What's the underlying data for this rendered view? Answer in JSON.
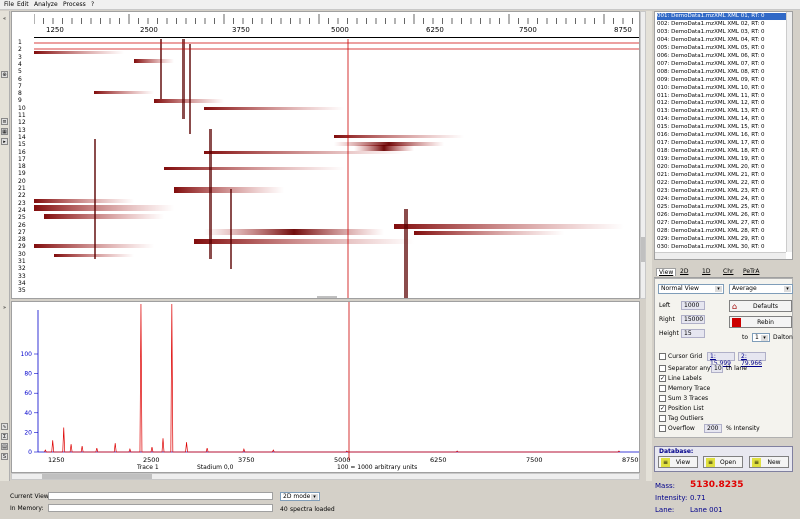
{
  "menu": [
    "File",
    "Edit",
    "Analyze",
    "Process",
    "?"
  ],
  "x_ticks": [
    "1250",
    "2500",
    "3750",
    "5000",
    "6250",
    "7500",
    "8750"
  ],
  "lanes": [
    "1",
    "2",
    "3",
    "4",
    "5",
    "6",
    "7",
    "8",
    "9",
    "10",
    "11",
    "12",
    "13",
    "14",
    "15",
    "16",
    "17",
    "18",
    "19",
    "20",
    "21",
    "22",
    "23",
    "24",
    "25",
    "26",
    "27",
    "28",
    "29",
    "30",
    "31",
    "32",
    "33",
    "34",
    "35"
  ],
  "spectrum": {
    "y_ticks": [
      "100",
      "80",
      "60",
      "40",
      "20",
      "0"
    ],
    "x_ticks": [
      "1250",
      "2500",
      "3750",
      "5000",
      "6250",
      "7500",
      "8750"
    ],
    "bottom_labels": [
      "Trace 1",
      "Stadium 0,0",
      "100 = 1000 arbitrary units"
    ]
  },
  "chart_data": {
    "type": "line",
    "title": "",
    "xlabel": "",
    "ylabel": "",
    "ylim": [
      0,
      100
    ],
    "xlim": [
      800,
      9000
    ],
    "x": [
      900,
      1000,
      1150,
      1250,
      1400,
      1600,
      1850,
      2050,
      2200,
      2350,
      2500,
      2620,
      2820,
      3100,
      3600,
      4000,
      5000,
      6500,
      8700
    ],
    "series": [
      {
        "values": [
          2,
          12,
          25,
          8,
          6,
          4,
          9,
          3,
          100,
          5,
          14,
          100,
          10,
          4,
          3,
          2,
          1,
          1,
          1
        ]
      }
    ]
  },
  "sample_list": [
    "001: DemoData1.mzXML XML 01, RT: 0",
    "002: DemoData1.mzXML XML 02, RT: 0",
    "003: DemoData1.mzXML XML 03, RT: 0",
    "004: DemoData1.mzXML XML 04, RT: 0",
    "005: DemoData1.mzXML XML 05, RT: 0",
    "006: DemoData1.mzXML XML 06, RT: 0",
    "007: DemoData1.mzXML XML 07, RT: 0",
    "008: DemoData1.mzXML XML 08, RT: 0",
    "009: DemoData1.mzXML XML 09, RT: 0",
    "010: DemoData1.mzXML XML 10, RT: 0",
    "011: DemoData1.mzXML XML 11, RT: 0",
    "012: DemoData1.mzXML XML 12, RT: 0",
    "013: DemoData1.mzXML XML 13, RT: 0",
    "014: DemoData1.mzXML XML 14, RT: 0",
    "015: DemoData1.mzXML XML 15, RT: 0",
    "016: DemoData1.mzXML XML 16, RT: 0",
    "017: DemoData1.mzXML XML 17, RT: 0",
    "018: DemoData1.mzXML XML 18, RT: 0",
    "019: DemoData1.mzXML XML 19, RT: 0",
    "020: DemoData1.mzXML XML 20, RT: 0",
    "021: DemoData1.mzXML XML 21, RT: 0",
    "022: DemoData1.mzXML XML 22, RT: 0",
    "023: DemoData1.mzXML XML 23, RT: 0",
    "024: DemoData1.mzXML XML 24, RT: 0",
    "025: DemoData1.mzXML XML 25, RT: 0",
    "026: DemoData1.mzXML XML 26, RT: 0",
    "027: DemoData1.mzXML XML 27, RT: 0",
    "028: DemoData1.mzXML XML 28, RT: 0",
    "029: DemoData1.mzXML XML 29, RT: 0",
    "030: DemoData1.mzXML XML 30, RT: 0"
  ],
  "tabs": [
    "View",
    "2D",
    "1D",
    "Chr",
    "PeTrA"
  ],
  "view_mode": "Normal View",
  "average_mode": "Average",
  "fields": {
    "left_label": "Left",
    "left_value": "1000",
    "right_label": "Right",
    "right_value": "15000",
    "height_label": "Height",
    "height_value": "15",
    "to_label": "to",
    "to_value": "1",
    "dalton_label": "Dalton"
  },
  "buttons": {
    "defaults": "Defaults",
    "rebin": "Rebin",
    "view": "View",
    "open": "Open",
    "new": "New"
  },
  "options": {
    "cursor_grid": "Cursor Grid",
    "cursor_grid_1": "1: 15.999",
    "cursor_grid_2": "2: 79.966",
    "separator_any": "Separator any",
    "separator_value": "10",
    "separator_unit": "th lane",
    "line_labels": "Line Labels",
    "memory_trace": "Memory Trace",
    "sum_traces": "Sum 3 Traces",
    "position_list": "Position List",
    "tag_outliers": "Tag Outliers",
    "overflow": "Overflow",
    "overflow_value": "200",
    "overflow_unit": "% Intensity"
  },
  "checked": {
    "line_labels": true,
    "position_list": true,
    "cursor_grid": false,
    "separator_any": false,
    "memory_trace": false,
    "sum_traces": false,
    "tag_outliers": false,
    "overflow": false
  },
  "database_label": "Database:",
  "readout": {
    "mass_label": "Mass:",
    "mass_value": "5130.8235",
    "intensity_label": "Intensity:",
    "intensity_value": "0.71",
    "lane_label": "Lane:",
    "lane_value": "Lane 001"
  },
  "status": {
    "current_view_label": "Current View:",
    "in_memory_label": "In Memory:",
    "mode_value": "2D mode",
    "spectra_count": "40",
    "spectra_loaded_label": "spectra loaded"
  },
  "colors": {
    "accent_red": "#cc0000",
    "selection_blue": "#3169c6",
    "mass_red": "#e00000"
  }
}
